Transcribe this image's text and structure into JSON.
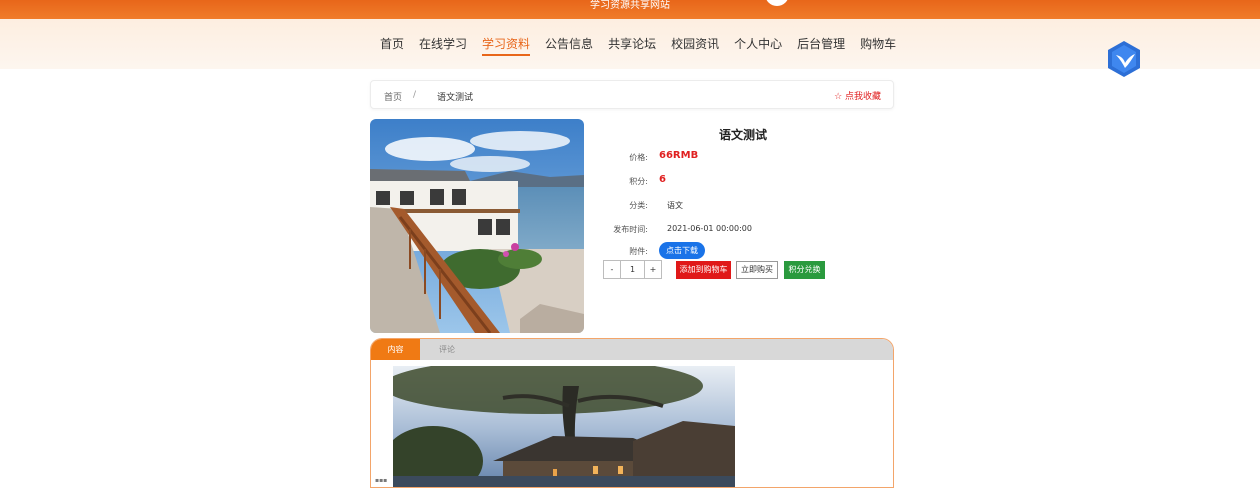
{
  "header": {
    "site_title": "学习资源共享网站",
    "accent_color": "#e8661a"
  },
  "nav": {
    "items": [
      "首页",
      "在线学习",
      "学习资料",
      "公告信息",
      "共享论坛",
      "校园资讯",
      "个人中心",
      "后台管理",
      "购物车"
    ],
    "active": "学习资料",
    "badge_icon": "bird-hexagon-icon"
  },
  "breadcrumb": {
    "home": "首页",
    "separator": "/",
    "current": "语文测试",
    "favorite": "☆ 点我收藏"
  },
  "detail": {
    "title": "语文测试",
    "price_label": "价格:",
    "price_value": "66RMB",
    "points_label": "积分:",
    "points_value": "6",
    "category_label": "分类:",
    "category_value": "语文",
    "published_label": "发布时间:",
    "published_value": "2021-06-01 00:00:00",
    "attachment_label": "附件:",
    "download_label": "点击下载"
  },
  "purchase": {
    "minus": "-",
    "quantity": "1",
    "plus": "+",
    "add_to_cart": "添加到购物车",
    "buy_now": "立即购买",
    "points_exchange": "积分兑换"
  },
  "tabs": {
    "content": "内容",
    "comments": "评论"
  }
}
